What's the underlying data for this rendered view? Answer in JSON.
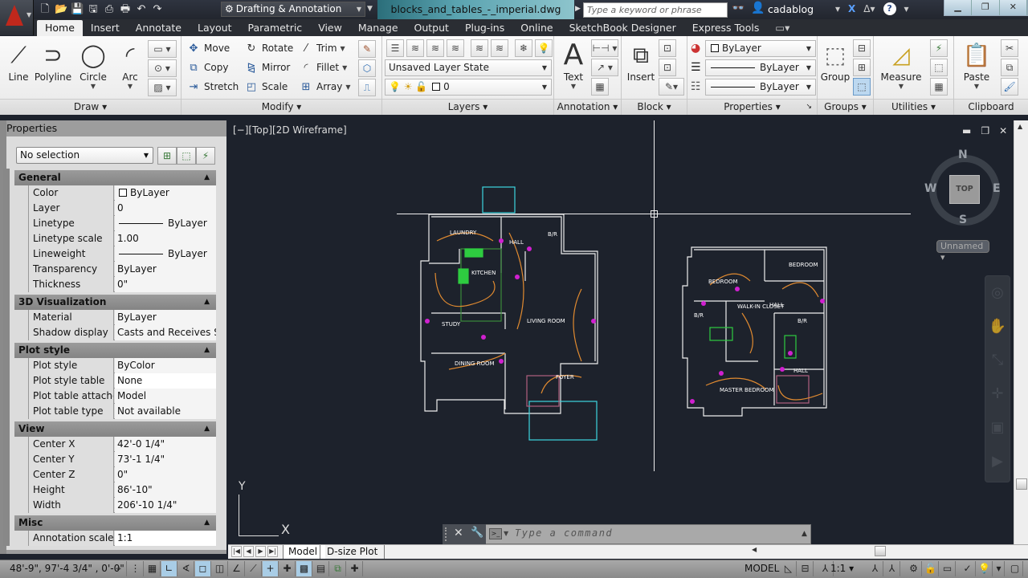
{
  "titlebar": {
    "workspace": "Drafting & Annotation",
    "document_title": "blocks_and_tables_-_imperial.dwg",
    "search_placeholder": "Type a keyword or phrase",
    "user": "cadablog"
  },
  "ribbon_tabs": [
    "Home",
    "Insert",
    "Annotate",
    "Layout",
    "Parametric",
    "View",
    "Manage",
    "Output",
    "Plug-ins",
    "Online",
    "SketchBook Designer",
    "Express Tools"
  ],
  "ribbon": {
    "draw": {
      "title": "Draw",
      "line": "Line",
      "polyline": "Polyline",
      "circle": "Circle",
      "arc": "Arc"
    },
    "modify": {
      "title": "Modify",
      "move": "Move",
      "rotate": "Rotate",
      "trim": "Trim",
      "copy": "Copy",
      "mirror": "Mirror",
      "fillet": "Fillet",
      "stretch": "Stretch",
      "scale": "Scale",
      "array": "Array"
    },
    "layers": {
      "title": "Layers",
      "layer_state": "Unsaved Layer State",
      "current_layer": "0"
    },
    "annotation": {
      "title": "Annotation",
      "text": "Text"
    },
    "block": {
      "title": "Block",
      "insert": "Insert"
    },
    "properties": {
      "title": "Properties",
      "color": "ByLayer",
      "lineweight": "ByLayer",
      "linetype": "ByLayer"
    },
    "groups": {
      "title": "Groups",
      "group": "Group"
    },
    "utilities": {
      "title": "Utilities",
      "measure": "Measure"
    },
    "clipboard": {
      "title": "Clipboard",
      "paste": "Paste"
    }
  },
  "properties_palette": {
    "title": "Properties",
    "selection": "No selection",
    "categories": [
      {
        "name": "General",
        "rows": [
          {
            "key": "Color",
            "value": "ByLayer"
          },
          {
            "key": "Layer",
            "value": "0"
          },
          {
            "key": "Linetype",
            "value": "ByLayer"
          },
          {
            "key": "Linetype scale",
            "value": "1.00"
          },
          {
            "key": "Lineweight",
            "value": "ByLayer"
          },
          {
            "key": "Transparency",
            "value": "ByLayer"
          },
          {
            "key": "Thickness",
            "value": "0\""
          }
        ]
      },
      {
        "name": "3D Visualization",
        "rows": [
          {
            "key": "Material",
            "value": "ByLayer"
          },
          {
            "key": "Shadow display",
            "value": "Casts and Receives Sh..."
          }
        ]
      },
      {
        "name": "Plot style",
        "rows": [
          {
            "key": "Plot style",
            "value": "ByColor"
          },
          {
            "key": "Plot style table",
            "value": "None"
          },
          {
            "key": "Plot table attache...",
            "value": "Model"
          },
          {
            "key": "Plot table type",
            "value": "Not available"
          }
        ]
      },
      {
        "name": "View",
        "rows": [
          {
            "key": "Center X",
            "value": "42'-0 1/4\""
          },
          {
            "key": "Center Y",
            "value": "73'-1 1/4\""
          },
          {
            "key": "Center Z",
            "value": "0\""
          },
          {
            "key": "Height",
            "value": "86'-10\""
          },
          {
            "key": "Width",
            "value": "206'-10 1/4\""
          }
        ]
      },
      {
        "name": "Misc",
        "rows": [
          {
            "key": "Annotation scale",
            "value": "1:1"
          }
        ]
      }
    ]
  },
  "viewport": {
    "label": "[−][Top][2D Wireframe]",
    "viewcube": {
      "top": "TOP",
      "n": "N",
      "s": "S",
      "e": "E",
      "w": "W",
      "ucs": "Unnamed"
    },
    "ucs_x": "X",
    "ucs_y": "Y",
    "floorplan_1_rooms": [
      "LAUNDRY",
      "KITCHEN",
      "HALL",
      "B/R",
      "LIVING ROOM",
      "STUDY",
      "DINING ROOM",
      "FOYER"
    ],
    "floorplan_2_rooms": [
      "BEDROOM",
      "BEDROOM",
      "WALK-IN CLOSET",
      "HALL",
      "B/R",
      "B/R",
      "HALL",
      "MASTER BEDROOM"
    ]
  },
  "command_line": {
    "placeholder": "Type a command"
  },
  "layout_tabs": [
    "Model",
    "D-size Plot"
  ],
  "statusbar": {
    "coordinates": "48'-9\",  97'-4 3/4\" , 0'-0\"",
    "space": "MODEL",
    "annotation_scale": "1:1"
  }
}
